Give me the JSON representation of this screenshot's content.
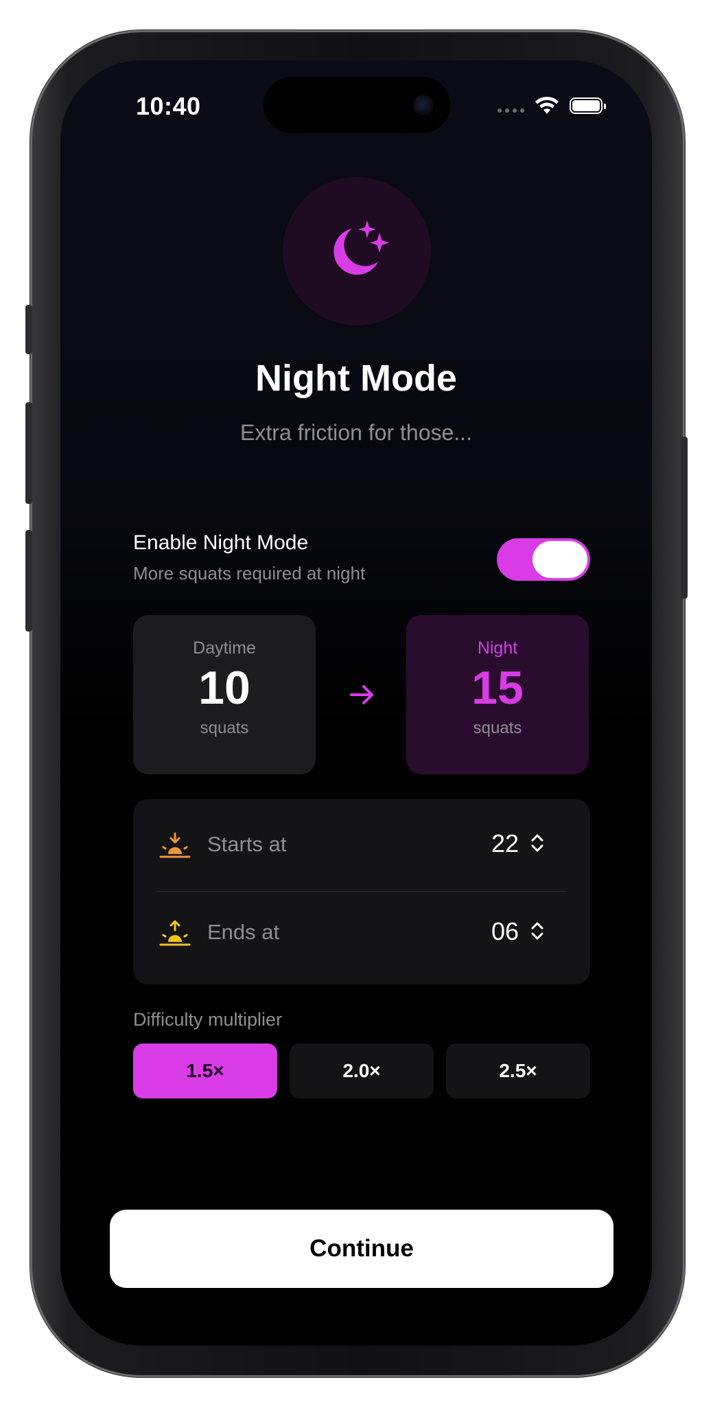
{
  "status_bar": {
    "time": "10:40"
  },
  "header": {
    "icon": "moon-stars-icon",
    "title": "Night Mode",
    "subtitle": "Extra friction for those..."
  },
  "night_toggle": {
    "title": "Enable Night Mode",
    "subtitle": "More squats required at night",
    "enabled": true
  },
  "comparison": {
    "day": {
      "label": "Daytime",
      "value": "10",
      "unit": "squats"
    },
    "night": {
      "label": "Night",
      "value": "15",
      "unit": "squats"
    }
  },
  "schedule": {
    "start": {
      "label": "Starts at",
      "value": "22",
      "icon": "sunset-icon"
    },
    "end": {
      "label": "Ends at",
      "value": "06",
      "icon": "sunrise-icon"
    }
  },
  "multiplier": {
    "label": "Difficulty multiplier",
    "options": [
      "1.5×",
      "2.0×",
      "2.5×"
    ],
    "selected": "1.5×"
  },
  "continue_label": "Continue",
  "colors": {
    "accent": "#d93ce6",
    "background": "#000000",
    "card": "#1c1c1e",
    "night_card": "#2a0c2e",
    "sunset": "#f0963c",
    "sunrise": "#f5c518"
  }
}
